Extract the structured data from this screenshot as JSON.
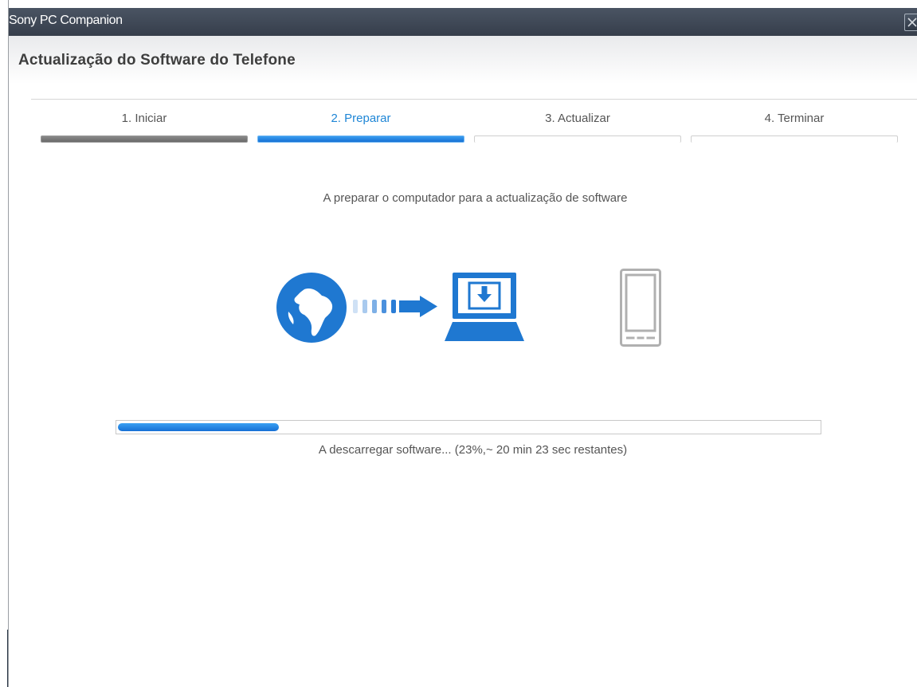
{
  "window": {
    "app_title": "Sony PC Companion",
    "page_title": "Actualização do Software do Telefone"
  },
  "steps": [
    {
      "label": "1. Iniciar",
      "state": "done"
    },
    {
      "label": "2. Preparar",
      "state": "active"
    },
    {
      "label": "3. Actualizar",
      "state": "pending"
    },
    {
      "label": "4. Terminar",
      "state": "pending"
    }
  ],
  "main": {
    "subtitle": "A preparar o computador para a actualização de software",
    "icons": [
      "globe-icon",
      "dotted-arrow-icon",
      "laptop-download-icon",
      "phone-icon"
    ],
    "progress": {
      "fraction": 0.23,
      "text": "A descarregar software... (23%,~ 20 min 23 sec restantes)"
    }
  },
  "colors": {
    "accent": "#1f78d1",
    "titlebar": "#3f4756",
    "inactive_device": "#b0b0b0"
  }
}
